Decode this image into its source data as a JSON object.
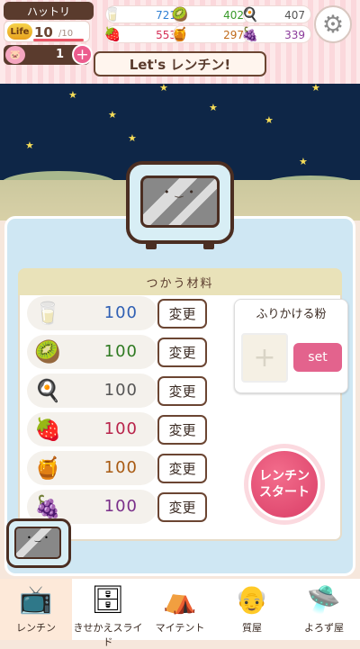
{
  "player": {
    "name": "ハットリ",
    "life_label": "Life",
    "life": "10",
    "life_max": "/10",
    "coins": "1",
    "plus": "+"
  },
  "resources": [
    {
      "icon": "milk",
      "glyph": "🥛",
      "value": "721",
      "color": "#2f7fd3"
    },
    {
      "icon": "kiwi",
      "glyph": "🥝",
      "value": "402",
      "color": "#3a9a2a"
    },
    {
      "icon": "egg",
      "glyph": "🍳",
      "value": "407",
      "color": "#555555"
    },
    {
      "icon": "strawberry",
      "glyph": "🍓",
      "value": "553",
      "color": "#d52f57"
    },
    {
      "icon": "honey",
      "glyph": "🍯",
      "value": "297",
      "color": "#c06a1a"
    },
    {
      "icon": "grape",
      "glyph": "🍇",
      "value": "339",
      "color": "#8a3a9a"
    }
  ],
  "settings_icon": "⚙",
  "banner": "Let's レンチン!",
  "ingredients_title": "つかう材料",
  "ingredients": [
    {
      "icon": "milk",
      "glyph": "🥛",
      "qty": "100",
      "color": "#2f5fb3",
      "button": "変更"
    },
    {
      "icon": "kiwi",
      "glyph": "🥝",
      "qty": "100",
      "color": "#2f7a22",
      "button": "変更"
    },
    {
      "icon": "egg",
      "glyph": "🍳",
      "qty": "100",
      "color": "#555555",
      "button": "変更"
    },
    {
      "icon": "strawberry",
      "glyph": "🍓",
      "qty": "100",
      "color": "#b8234a",
      "button": "変更"
    },
    {
      "icon": "honey",
      "glyph": "🍯",
      "qty": "100",
      "color": "#a85a12",
      "button": "変更"
    },
    {
      "icon": "grape",
      "glyph": "🍇",
      "qty": "100",
      "color": "#7a2f8a",
      "button": "変更"
    }
  ],
  "sprinkle": {
    "title": "ふりかける粉",
    "slot": "+",
    "set": "set"
  },
  "start_button": {
    "line1": "レンチン",
    "line2": "スタート"
  },
  "nav": [
    {
      "label": "レンチン",
      "icon": "microwave",
      "glyph": "📺",
      "active": true
    },
    {
      "label": "きせかえスライド",
      "icon": "dresser",
      "glyph": "🗄",
      "active": false
    },
    {
      "label": "マイテント",
      "icon": "tent",
      "glyph": "⛺",
      "active": false
    },
    {
      "label": "質屋",
      "icon": "pawnshop-man",
      "glyph": "👴",
      "active": false
    },
    {
      "label": "よろず屋",
      "icon": "ufo",
      "glyph": "🛸",
      "active": false
    }
  ]
}
